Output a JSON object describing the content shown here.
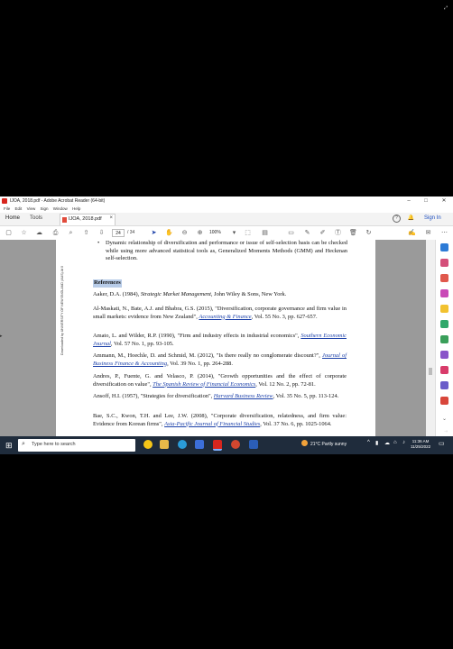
{
  "window": {
    "title": "IJOA, 2018.pdf - Adobe Acrobat Reader (64-bit)",
    "controls": [
      "–",
      "□",
      "✕"
    ]
  },
  "menu": [
    "File",
    "Edit",
    "View",
    "Sign",
    "Window",
    "Help"
  ],
  "tabs": {
    "home": "Home",
    "tools": "Tools",
    "document": "IJOA, 2018.pdf",
    "close": "×",
    "sign_in": "Sign In"
  },
  "toolbar": {
    "page_current": "24",
    "page_total": "/ 34",
    "zoom": "100%"
  },
  "document": {
    "side_stamp": "Downloaded by UNIVERSITY OF NEW ENGLAND (AUS) At 0",
    "bullet": "Dynamic relationship of diversification and performance or issue of self-selection basis can be checked while using more advanced statistical tools as, Generalized Moments Methods (GMM) and Heckman self-selection.",
    "references_heading": "References",
    "refs": [
      {
        "pre": "Aaker, D.A. (1984), ",
        "italic": "Strategic Market Management",
        "link": "",
        "post": ", John Wiley & Sons, New York."
      },
      {
        "pre": "Al-Maskati, N., Bate, A.J. and Bhabra, G.S. (2015), \"Diversification, corporate governance and firm value in small markets: evidence from New Zealand\", ",
        "italic": "",
        "link": "Accounting & Finance",
        "post": ", Vol. 55 No. 3, pp. 627-657."
      },
      {
        "pre": "Amato, L. and Wilder, R.P. (1990), \"Firm and industry effects in industrial economics\", ",
        "italic": "",
        "link": "Southern Economic Journal",
        "post": ", Vol. 57 No. 1, pp. 93-105."
      },
      {
        "pre": "Ammann, M., Hoechle, D. and Schmid, M. (2012), \"Is there really no conglomerate discount?\", ",
        "italic": "",
        "link": "Journal of Business Finance & Accounting",
        "post": ", Vol. 39 No. 1, pp. 264-288."
      },
      {
        "pre": "Andres, P., Fuente, G. and Velasco, P. (2014), \"Growth opportunities and the effect of corporate diversification on value\", ",
        "italic": "",
        "link": "The Spanish Review of Financial Economics",
        "post": ", Vol. 12 No. 2, pp. 72-81."
      },
      {
        "pre": "Ansoff, H.I. (1957), \"Strategies for diversification\", ",
        "italic": "",
        "link": "Harvard Business Review",
        "post": ", Vol. 35 No. 5, pp. 113-124."
      },
      {
        "pre": "Bae, S.C., Kwon, T.H. and Lee, J.W. (2008), \"Corporate diversification, relatedness, and firm value: Evidence from Korean firms\", ",
        "italic": "",
        "link": "Asia-Pacific Journal of Financial Studies",
        "post": ", Vol. 37 No. 6, pp. 1025-1064."
      }
    ]
  },
  "taskbar": {
    "search_placeholder": "Type here to search",
    "weather": "21°C  Partly sunny",
    "time": "11:36 AM",
    "date": "11/25/2022"
  },
  "colors": {
    "acrobat_red": "#d7261e",
    "link_blue": "#1a3fa8",
    "taskbar": "#1f2c3c",
    "highlight": "#b8cce8"
  }
}
